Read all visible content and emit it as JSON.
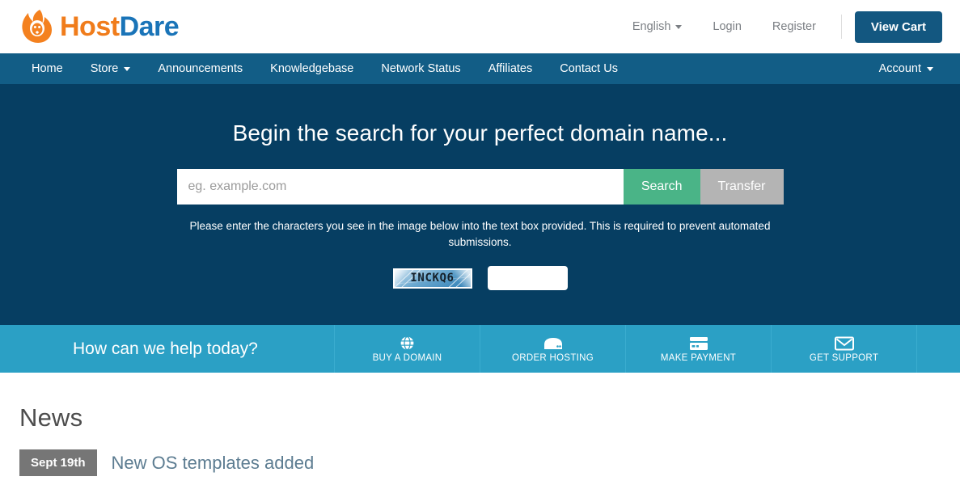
{
  "header": {
    "logo": {
      "icon": "flame-lion-icon",
      "text_primary": "Host",
      "text_secondary": "Dare"
    },
    "language": "English",
    "login": "Login",
    "register": "Register",
    "view_cart": "View Cart"
  },
  "nav": {
    "items": [
      {
        "label": "Home",
        "has_caret": false
      },
      {
        "label": "Store",
        "has_caret": true
      },
      {
        "label": "Announcements",
        "has_caret": false
      },
      {
        "label": "Knowledgebase",
        "has_caret": false
      },
      {
        "label": "Network Status",
        "has_caret": false
      },
      {
        "label": "Affiliates",
        "has_caret": false
      },
      {
        "label": "Contact Us",
        "has_caret": false
      }
    ],
    "account": "Account"
  },
  "hero": {
    "title": "Begin the search for your perfect domain name...",
    "search_placeholder": "eg. example.com",
    "search_value": "",
    "search_button": "Search",
    "transfer_button": "Transfer",
    "captcha_note": "Please enter the characters you see in the image below into the text box provided. This is required to prevent automated submissions.",
    "captcha_text": "INCKQ6",
    "captcha_input_value": "",
    "captcha_input_placeholder": ""
  },
  "helpbar": {
    "title": "How can we help today?",
    "items": [
      {
        "label": "BUY A DOMAIN",
        "icon": "globe-icon"
      },
      {
        "label": "ORDER HOSTING",
        "icon": "server-icon"
      },
      {
        "label": "MAKE PAYMENT",
        "icon": "credit-card-icon"
      },
      {
        "label": "GET SUPPORT",
        "icon": "envelope-icon"
      }
    ]
  },
  "news": {
    "heading": "News",
    "items": [
      {
        "date": "Sept 19th",
        "title": "New OS templates added"
      }
    ]
  },
  "colors": {
    "hero_bg": "#063e62",
    "nav_bg": "#125d86",
    "helpbar_bg": "#2ba0c5",
    "accent_orange": "#f07c1b",
    "accent_blue": "#1a74b8",
    "search_green": "#4ab487",
    "transfer_gray": "#b4b4b4",
    "cart_button": "#135780",
    "news_badge": "#767676",
    "news_link": "#5c7c91"
  }
}
